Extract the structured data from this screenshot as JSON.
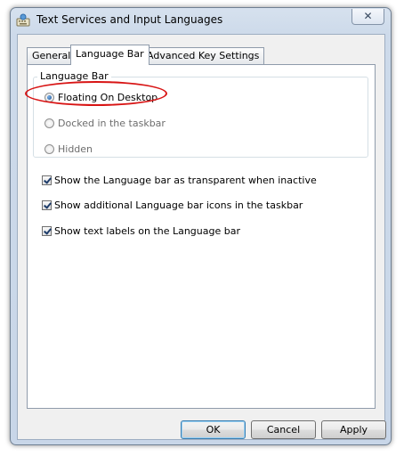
{
  "window": {
    "title": "Text Services and Input Languages",
    "close_glyph": "✕"
  },
  "tabs": [
    {
      "label": "General",
      "active": false
    },
    {
      "label": "Language Bar",
      "active": true
    },
    {
      "label": "Advanced Key Settings",
      "active": false
    }
  ],
  "language_bar_group": {
    "title": "Language Bar",
    "options": [
      {
        "label": "Floating On Desktop",
        "selected": true,
        "enabled": true
      },
      {
        "label": "Docked in the taskbar",
        "selected": false,
        "enabled": false
      },
      {
        "label": "Hidden",
        "selected": false,
        "enabled": false
      }
    ]
  },
  "checkboxes": [
    {
      "label": "Show the Language bar as transparent when inactive",
      "checked": true
    },
    {
      "label": "Show additional Language bar icons in the taskbar",
      "checked": true
    },
    {
      "label": "Show text labels on the Language bar",
      "checked": true
    }
  ],
  "buttons": {
    "ok": "OK",
    "cancel": "Cancel",
    "apply": "Apply"
  },
  "annotation_color": "#d81414"
}
